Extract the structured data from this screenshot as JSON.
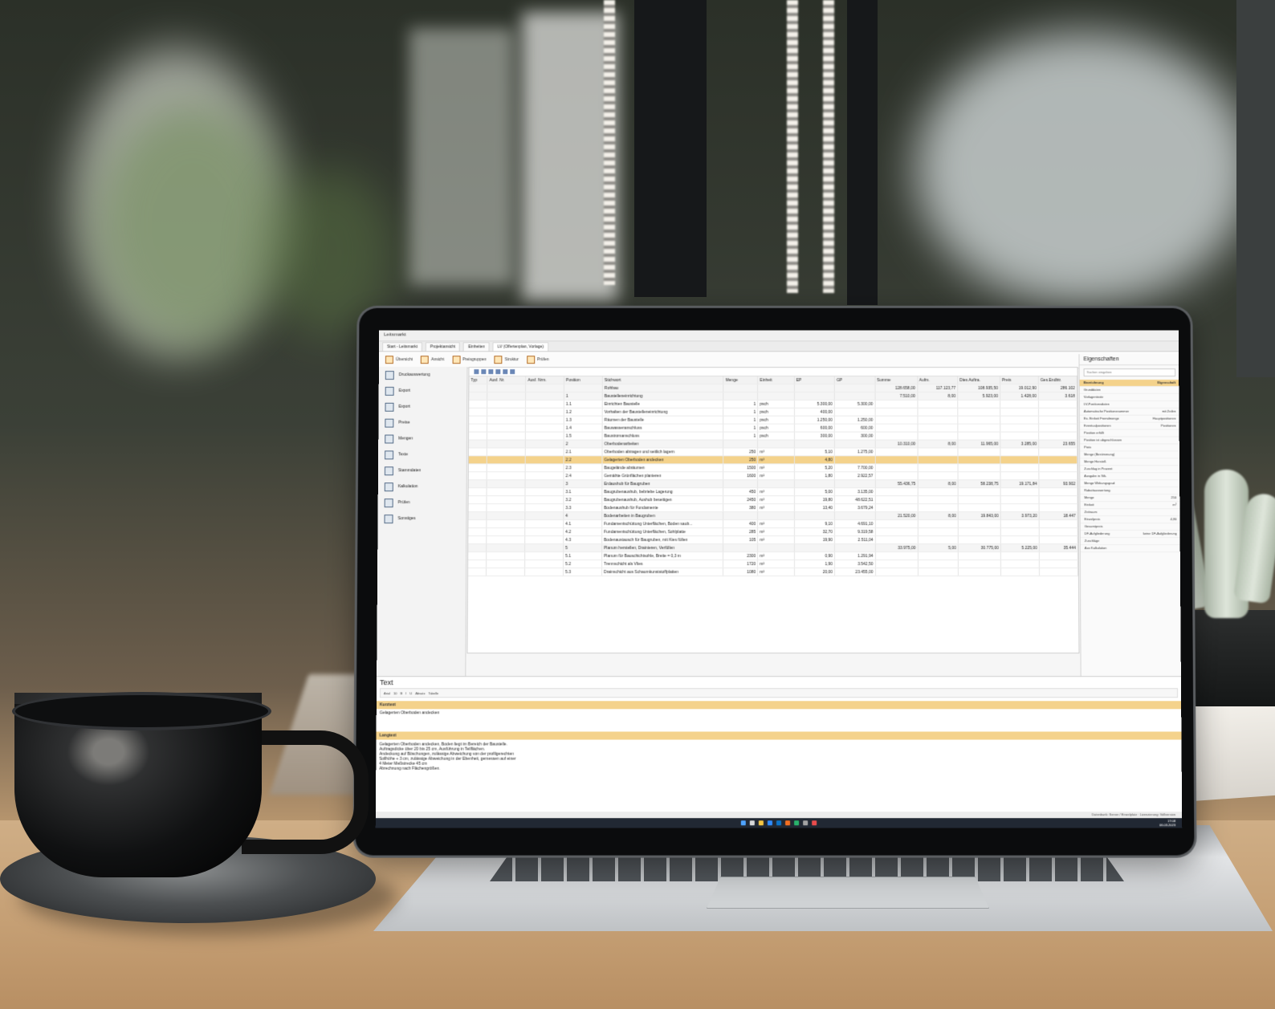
{
  "app": {
    "title": "Leitsmarkt",
    "tabs": [
      "Start - Leitsmarkt",
      "Projektansicht",
      "Einheiten",
      "LV (Offertenplan, Vorlage)"
    ]
  },
  "ribbon": {
    "items": [
      "Übersicht",
      "Ansicht",
      "Preisgruppen",
      "Struktur",
      "Prüfen"
    ]
  },
  "left_panel": {
    "items": [
      "Druckauswertung",
      "Export",
      "Export",
      "Preise",
      "Mengen",
      "Texte",
      "Stammdaten",
      "Kalkulation",
      "Prüfen",
      "Sonstiges"
    ]
  },
  "table": {
    "headers": [
      "Typ",
      "Ausf. Nr.",
      "Ausf. Nrm.",
      "Position",
      "Stichwort",
      "Menge",
      "Einheit",
      "EP",
      "GP",
      "Summe",
      "Aufm.",
      "Dies Auftra.",
      "Preis",
      "Ges.Endbtr."
    ],
    "rows": [
      {
        "cells": [
          "",
          "",
          "",
          "",
          "Rohbau",
          "",
          "",
          "",
          "",
          "128.658,00",
          "117.123,77",
          "108.935,50",
          "19.012,90",
          "286.102"
        ],
        "type": "group"
      },
      {
        "cells": [
          "",
          "",
          "",
          "1",
          "Baustelleneinrichtung",
          "",
          "",
          "",
          "",
          "7.510,00",
          "8,00",
          "5.923,00",
          "1.428,00",
          "3.618"
        ],
        "type": "group"
      },
      {
        "cells": [
          "",
          "",
          "",
          "1.1",
          "Einrichten Baustelle",
          "1",
          "psch",
          "5.300,00",
          "5.300,00",
          "",
          "",
          "",
          "",
          ""
        ],
        "type": ""
      },
      {
        "cells": [
          "",
          "",
          "",
          "1.2",
          "Vorhalten der Baustelleneinrichtung",
          "1",
          "psch",
          "400,00",
          "",
          "",
          "",
          "",
          "",
          ""
        ],
        "type": ""
      },
      {
        "cells": [
          "",
          "",
          "",
          "1.3",
          "Räumen der Baustelle",
          "1",
          "psch",
          "1.250,00",
          "1.250,00",
          "",
          "",
          "",
          "",
          ""
        ],
        "type": ""
      },
      {
        "cells": [
          "",
          "",
          "",
          "1.4",
          "Bauwasseranschluss",
          "1",
          "psch",
          "600,00",
          "600,00",
          "",
          "",
          "",
          "",
          ""
        ],
        "type": ""
      },
      {
        "cells": [
          "",
          "",
          "",
          "1.5",
          "Baustromanschluss",
          "1",
          "psch",
          "300,00",
          "300,00",
          "",
          "",
          "",
          "",
          ""
        ],
        "type": ""
      },
      {
        "cells": [
          "",
          "",
          "",
          "2",
          "Oberbodenarbeiten",
          "",
          "",
          "",
          "",
          "10.310,00",
          "8,00",
          "11.965,00",
          "3.285,00",
          "23.655"
        ],
        "type": "group"
      },
      {
        "cells": [
          "",
          "",
          "",
          "2.1",
          "Oberboden abtragen und seitlich lagern",
          "250",
          "m³",
          "5,10",
          "1.275,00",
          "",
          "",
          "",
          "",
          ""
        ],
        "type": ""
      },
      {
        "cells": [
          "",
          "",
          "",
          "2.2",
          "Gelagerten Oberboden andecken",
          "250",
          "m³",
          "4,80",
          "",
          "",
          "",
          "",
          "",
          ""
        ],
        "type": "highlight"
      },
      {
        "cells": [
          "",
          "",
          "",
          "2.3",
          "Baugelände abräumen",
          "1500",
          "m²",
          "5,20",
          "7.700,00",
          "",
          "",
          "",
          "",
          ""
        ],
        "type": ""
      },
      {
        "cells": [
          "",
          "",
          "",
          "2.4",
          "Gemähte Grünflächen planieren",
          "1600",
          "m²",
          "1,80",
          "2.922,57",
          "",
          "",
          "",
          "",
          ""
        ],
        "type": ""
      },
      {
        "cells": [
          "",
          "",
          "",
          "3",
          "Erdaushub für Baugruben",
          "",
          "",
          "",
          "",
          "55.436,75",
          "8,00",
          "58.238,75",
          "19.171,84",
          "93.902"
        ],
        "type": "group"
      },
      {
        "cells": [
          "",
          "",
          "",
          "3.1",
          "Baugrubenaushub, bebriebe Lagerung",
          "450",
          "m³",
          "5,00",
          "3.135,00",
          "",
          "",
          "",
          "",
          ""
        ],
        "type": ""
      },
      {
        "cells": [
          "",
          "",
          "",
          "3.2",
          "Baugrubenaushub, Aushub beseitigen",
          "2450",
          "m³",
          "19,80",
          "48.622,51",
          "",
          "",
          "",
          "",
          ""
        ],
        "type": ""
      },
      {
        "cells": [
          "",
          "",
          "",
          "3.3",
          "Bodenaushub für Fundamente",
          "380",
          "m³",
          "13,40",
          "3.679,24",
          "",
          "",
          "",
          "",
          ""
        ],
        "type": ""
      },
      {
        "cells": [
          "",
          "",
          "",
          "4",
          "Bodenarbeiten in Baugruben",
          "",
          "",
          "",
          "",
          "21.520,00",
          "8,00",
          "19.843,00",
          "3.973,20",
          "18.447"
        ],
        "type": "group"
      },
      {
        "cells": [
          "",
          "",
          "",
          "4.1",
          "Fundamentschüttung Unterflächen, Boden saub...",
          "400",
          "m²",
          "9,10",
          "4.691,10",
          "",
          "",
          "",
          "",
          ""
        ],
        "type": ""
      },
      {
        "cells": [
          "",
          "",
          "",
          "4.2",
          "Fundamentschüttung Unterflächen, Sohlplatte",
          "285",
          "m²",
          "32,70",
          "9.319,58",
          "",
          "",
          "",
          "",
          ""
        ],
        "type": ""
      },
      {
        "cells": [
          "",
          "",
          "",
          "4.3",
          "Bodenaustausch für Baugruben, mit Kies füllen",
          "105",
          "m²",
          "19,90",
          "2.511,04",
          "",
          "",
          "",
          "",
          ""
        ],
        "type": ""
      },
      {
        "cells": [
          "",
          "",
          "",
          "5",
          "Planum herstellen, Drainieren, Verfüllen",
          "",
          "",
          "",
          "",
          "33.975,00",
          "5,00",
          "30.775,00",
          "5.225,00",
          "35.444"
        ],
        "type": "group"
      },
      {
        "cells": [
          "",
          "",
          "",
          "5.1",
          "Planum für Bauschichtsohle, Breite = 0,3 m",
          "2300",
          "m²",
          "0,90",
          "1.291,94",
          "",
          "",
          "",
          "",
          ""
        ],
        "type": ""
      },
      {
        "cells": [
          "",
          "",
          "",
          "5.2",
          "Trennschicht als Vlies",
          "1720",
          "m²",
          "1,90",
          "3.542,50",
          "",
          "",
          "",
          "",
          ""
        ],
        "type": ""
      },
      {
        "cells": [
          "",
          "",
          "",
          "5.3",
          "Drainschicht aus Schaumkunststoffplatten",
          "1080",
          "m²",
          "20,00",
          "23.455,00",
          "",
          "",
          "",
          "",
          ""
        ],
        "type": ""
      }
    ]
  },
  "properties": {
    "title": "Eigenschaften",
    "search_placeholder": "Suchen eingeben",
    "rows": [
      {
        "label": "Bezeichnung",
        "value": "Eigenschaft",
        "type": "h"
      },
      {
        "label": "Grunddaten",
        "value": "",
        "type": ""
      },
      {
        "label": "Vorlagentexte",
        "value": "",
        "type": ""
      },
      {
        "label": "LV-Positionsdaten",
        "value": "",
        "type": ""
      },
      {
        "label": "Automatische Positionsnummer",
        "value": "mit Zeilen",
        "type": ""
      },
      {
        "label": "Ex. Einheit Fremdmenge",
        "value": "Hauptpositionen",
        "type": ""
      },
      {
        "label": "Eventualpositionen",
        "value": "Positionen",
        "type": ""
      },
      {
        "label": "Position erfüllt",
        "value": "",
        "type": ""
      },
      {
        "label": "Position ist abgeschlossen",
        "value": "",
        "type": ""
      },
      {
        "label": "Preis",
        "value": "",
        "type": ""
      },
      {
        "label": "Menge (Bestimmung)",
        "value": "",
        "type": ""
      },
      {
        "label": "Menge Herstell.",
        "value": "",
        "type": ""
      },
      {
        "label": "Zuschlag in Prozent",
        "value": "",
        "type": ""
      },
      {
        "label": "Ausgabe in Stk.",
        "value": "",
        "type": ""
      },
      {
        "label": "Menge Wirkungsgrad",
        "value": "",
        "type": ""
      },
      {
        "label": "Rabattauswertung",
        "value": "",
        "type": ""
      },
      {
        "label": "Menge",
        "value": "250",
        "type": ""
      },
      {
        "label": "Einheit",
        "value": "m³",
        "type": ""
      },
      {
        "label": "Zeitraum",
        "value": "",
        "type": ""
      },
      {
        "label": "Einzelpreis",
        "value": "4,80",
        "type": ""
      },
      {
        "label": "Gesamtpreis",
        "value": "",
        "type": ""
      },
      {
        "label": "DF-Aufgliederung",
        "value": "keine DF-Aufgliederung",
        "type": ""
      },
      {
        "label": "Zuschläge",
        "value": "",
        "type": ""
      },
      {
        "label": "Aus Kalkulation",
        "value": "",
        "type": ""
      }
    ]
  },
  "text_panel": {
    "title": "Text",
    "format_items": [
      "Arial",
      "10",
      "B",
      "I",
      "U",
      "Absatz",
      "Tabelle"
    ],
    "short_label": "Kurztext",
    "short_text": "Gelagerten Oberboden andecken",
    "long_label": "Langtext",
    "long_lines": [
      "Gelagerten Oberboden andecken, Boden liegt im Bereich der Baustelle.",
      "Auftragsdicke über 20 bis 25 cm, Ausführung in Teilflächen.",
      "Andeckung auf Böschungen, zulässige Abweichung von der profilgerechten",
      "Sollhöhe + 3 cm, zulässige Abweichung in der Ebenheit, gemessen auf einer",
      "4 Meter Meßstrecke 45 cm",
      "Abrechnung nach Flächengrößen."
    ]
  },
  "status": {
    "text": "Datenbank: Server / Einzelplatz · Lizenzierung: Vollversion",
    "clock_time": "17:08",
    "clock_date": "06.03.2023"
  }
}
